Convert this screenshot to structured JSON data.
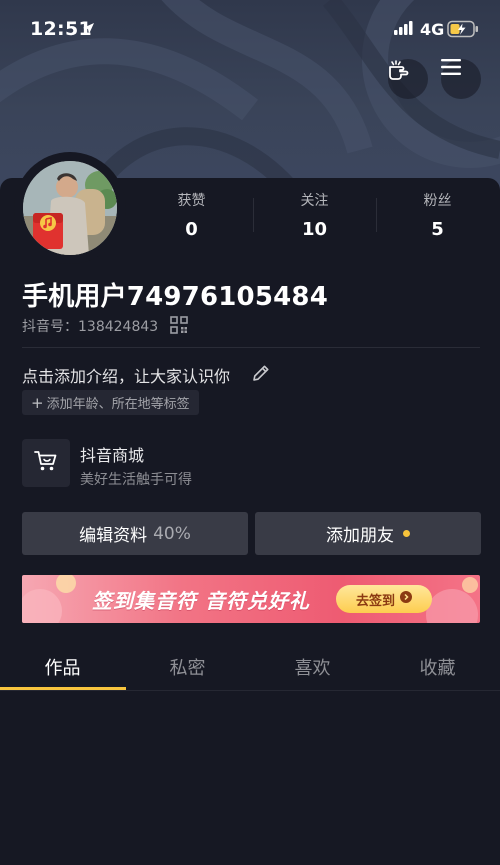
{
  "status_bar": {
    "time": "12:51",
    "network": "4G"
  },
  "header": {
    "gesture_icon": "hand-point-icon",
    "menu_icon": "hamburger-menu-icon"
  },
  "stats": [
    {
      "label": "获赞",
      "value": "0"
    },
    {
      "label": "关注",
      "value": "10"
    },
    {
      "label": "粉丝",
      "value": "5"
    }
  ],
  "profile": {
    "username": "手机用户74976105484",
    "douyin_id": "抖音号：138424843",
    "intro": "点击添加介绍，让大家认识你",
    "tag_chip": "添加年龄、所在地等标签"
  },
  "shop": {
    "title": "抖音商城",
    "subtitle": "美好生活触手可得"
  },
  "actions": {
    "edit_label": "编辑资料",
    "edit_percent": "40%",
    "add_friend_label": "添加朋友"
  },
  "promo": {
    "text": "签到集音符 音符兑好礼",
    "button": "去签到"
  },
  "tabs": [
    {
      "label": "作品",
      "active": true
    },
    {
      "label": "私密",
      "active": false
    },
    {
      "label": "喜欢",
      "active": false
    },
    {
      "label": "收藏",
      "active": false
    }
  ],
  "colors": {
    "accent": "#f8c53e",
    "background": "#161823",
    "button": "#393b46"
  }
}
